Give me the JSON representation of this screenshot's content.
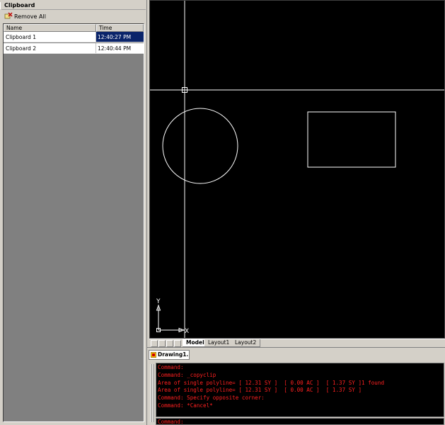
{
  "panel": {
    "title": "Clipboard",
    "toolbar": {
      "remove_all_label": "Remove All"
    },
    "list": {
      "headers": {
        "name": "Name",
        "time": "Time"
      },
      "rows": [
        {
          "name": "Clipboard 1",
          "time": "12:40:27 PM",
          "selected": true
        },
        {
          "name": "Clipboard 2",
          "time": "12:40:44 PM",
          "selected": false
        }
      ]
    }
  },
  "drawing": {
    "ucs": {
      "x_label": "X",
      "y_label": "Y"
    }
  },
  "layout_tabs": [
    "Model",
    "Layout1",
    "Layout2"
  ],
  "document_tab": {
    "label": "Drawing1..."
  },
  "command": {
    "history": [
      "Command:",
      "Command: _copyclip",
      "Area of single polyline= [ 12.31 SY ]  [ 0.00 AC ]  [ 1.37 SY ]1 found",
      "Area of single polyline= [ 12.31 SY ]  [ 0.00 AC ]  [ 1.37 SY ]",
      "Command: Specify opposite corner:",
      "Command: *Cancel*"
    ],
    "prompt": "Command:"
  },
  "colors": {
    "canvas_bg": "#000000",
    "entity": "#ffffff",
    "command_text": "#ff2020",
    "selection": "#0a246a"
  }
}
